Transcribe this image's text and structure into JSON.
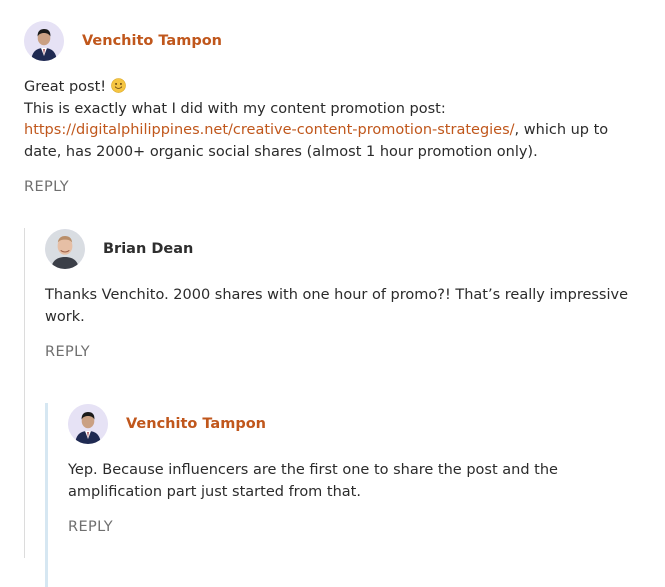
{
  "comments": [
    {
      "author": "Venchito Tampon",
      "lines": {
        "greeting": "Great post!",
        "intro": "This is exactly what I did with my content promotion post:",
        "link": "https://digitalphilippines.net/creative-content-promotion-strategies/",
        "after_link": ", which up to date, has 2000+ organic social shares (almost 1 hour promotion only)."
      },
      "reply": "REPLY"
    },
    {
      "author": "Brian Dean",
      "text": "Thanks Venchito. 2000 shares with one hour of promo?! That’s really impressive work.",
      "reply": "REPLY"
    },
    {
      "author": "Venchito Tampon",
      "text": "Yep. Because influencers are the first one to share the post and the amplification part just started from that.",
      "reply": "REPLY"
    }
  ],
  "colors": {
    "author_accent": "#c0571c",
    "thread_line": "#dcdcdc",
    "nested_line": "#d6e7f2"
  },
  "icons": {
    "emoji": "slightly-smiling-face-icon"
  }
}
